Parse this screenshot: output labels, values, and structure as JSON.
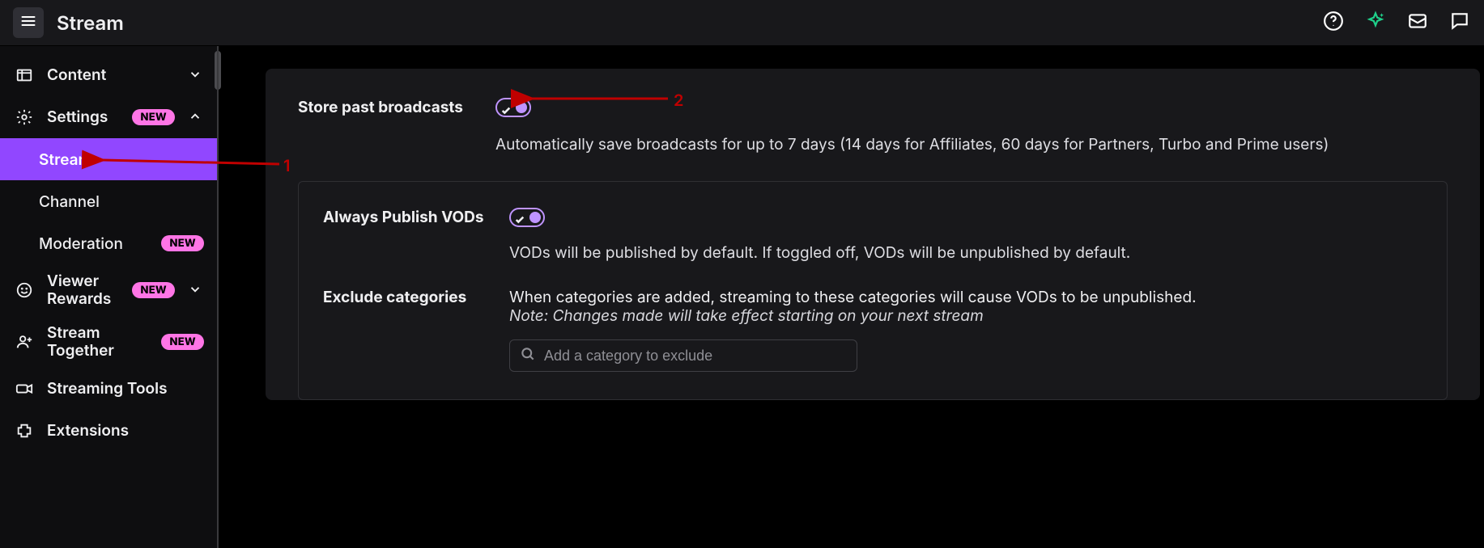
{
  "header": {
    "title": "Stream"
  },
  "sidebar": {
    "content": {
      "label": "Content"
    },
    "settings": {
      "label": "Settings",
      "badge": "NEW"
    },
    "settings_children": {
      "stream": "Stream",
      "channel": "Channel",
      "moderation": {
        "label": "Moderation",
        "badge": "NEW"
      }
    },
    "viewer_rewards": {
      "label": "Viewer Rewards",
      "badge": "NEW"
    },
    "stream_together": {
      "label": "Stream Together",
      "badge": "NEW"
    },
    "streaming_tools": {
      "label": "Streaming Tools"
    },
    "extensions": {
      "label": "Extensions"
    }
  },
  "settings_page": {
    "store_past": {
      "label": "Store past broadcasts",
      "toggle_on": true,
      "description": "Automatically save broadcasts for up to 7 days (14 days for Affiliates, 60 days for Partners, Turbo and Prime users)"
    },
    "always_publish": {
      "label": "Always Publish VODs",
      "toggle_on": true,
      "description": "VODs will be published by default. If toggled off, VODs will be unpublished by default."
    },
    "exclude": {
      "label": "Exclude categories",
      "description": "When categories are added, streaming to these categories will cause VODs to be unpublished.",
      "note": "Note: Changes made will take effect starting on your next stream",
      "placeholder": "Add a category to exclude"
    }
  },
  "annotations": {
    "one": "1",
    "two": "2"
  },
  "colors": {
    "accent": "#9147ff",
    "toggle": "#bf94ff",
    "badge": "#ff75e6",
    "annotation": "#c00000"
  }
}
